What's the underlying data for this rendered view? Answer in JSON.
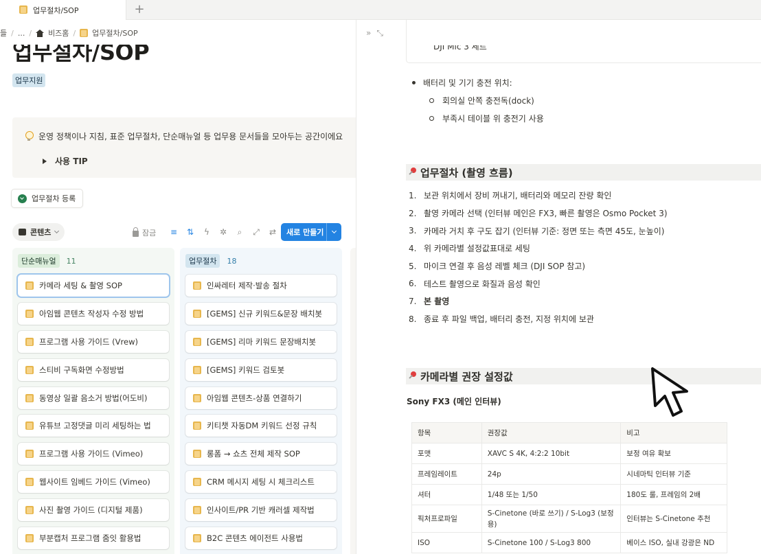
{
  "tabs": [
    {
      "label": "업무절차/SOP"
    }
  ],
  "breadcrumb": [
    "들",
    "...",
    "비즈홈",
    "업무절차/SOP"
  ],
  "page": {
    "title": "업무절차/SOP",
    "tag": "업무지원",
    "callout_text": "운영 정책이나 지침, 표준 업무절차, 단순매뉴얼 등 업무용 문서들을 모아두는 공간이에요",
    "toggle_label": "사용 TIP",
    "register_button": "업무절차 등록"
  },
  "view": {
    "name": "콘텐츠",
    "lock_label": "잠금",
    "new_button": "새로 만들기"
  },
  "board": {
    "columns": [
      {
        "name": "단순매뉴얼",
        "count": "11",
        "cards": [
          "카메라 세팅 & 촬영 SOP",
          "아임웹 콘텐츠 작성자 수정 방법",
          "프로그램 사용 가이드 (Vrew)",
          "스티비 구독화면 수정방법",
          "동영상 일괄 음소거 방법(어도비)",
          "유튜브 고정댓글 미리 세팅하는 법",
          "프로그램 사용 가이드 (Vimeo)",
          "웹사이트 임베드 가이드 (Vimeo)",
          "사진 촬영 가이드 (디지털 제품)",
          "부분캡처 프로그램 줌잇 활용법"
        ]
      },
      {
        "name": "업무절차",
        "count": "18",
        "cards": [
          "인싸레터 제작·발송 절차",
          "[GEMS] 신규 키워드&문장 배치봇",
          "[GEMS] 리마 키워드 문장배치봇",
          "[GEMS] 키워드 검토봇",
          "아임웹 콘텐츠-상품 연결하기",
          "키티챗 자동DM 키워드 선정 규칙",
          "롱폼 → 쇼츠 전체 제작 SOP",
          "CRM 메시지 세팅 시 체크리스트",
          "인사이트/PR 기반 캐러셀 제작법",
          "B2C 콘텐츠 에이전트 사용법"
        ]
      }
    ]
  },
  "doc": {
    "embed_cut_text": "DJI Mic 3 세트",
    "charging": {
      "title": "배터리 및 기기 충전 위치:",
      "items": [
        "회의실 안쪽 충전독(dock)",
        "부족시 테이블 위 충전기 사용"
      ]
    },
    "procedure_heading": "업무절차 (촬영 흐름)",
    "steps": [
      "보관 위치에서 장비 꺼내기, 배터리와 메모리 잔량 확인",
      "촬영 카메라 선택 (인터뷰 메인은 FX3, 빠른 촬영은 Osmo Pocket 3)",
      "카메라 거치 후 구도 잡기 (인터뷰 기준: 정면 또는 측면 45도, 눈높이)",
      "위 카메라별 설정값표대로 세팅",
      "마이크 연결 후 음성 레벨 체크 (DJI SOP 참고)",
      "테스트 촬영으로 화질과 음성 확인",
      "본 촬영",
      "종료 후 파일 백업, 배터리 충전, 지정 위치에 보관"
    ],
    "settings_heading": "카메라별 권장 설정값",
    "camera_name": "Sony FX3 (메인 인터뷰)",
    "table": {
      "headers": [
        "항목",
        "권장값",
        "비고"
      ],
      "rows": [
        [
          "포맷",
          "XAVC S 4K, 4:2:2 10bit",
          "보정 여유 확보"
        ],
        [
          "프레임레이트",
          "24p",
          "시네마틱 인터뷰 기준"
        ],
        [
          "셔터",
          "1/48 또는 1/50",
          "180도 룰, 프레임의 2배"
        ],
        [
          "픽처프로파일",
          "S-Cinetone (바로 쓰기) / S-Log3 (보정용)",
          "인터뷰는 S-Cinetone 추천"
        ],
        [
          "ISO",
          "S-Cinetone 100 / S-Log3 800",
          "베이스 ISO, 실내 강광은 ND"
        ]
      ]
    }
  },
  "colors": {
    "accent_blue": "#2383e2",
    "heading_pin_red": "#e03e3e",
    "manual_green": "#448361",
    "procedure_blue": "#337ea9"
  }
}
